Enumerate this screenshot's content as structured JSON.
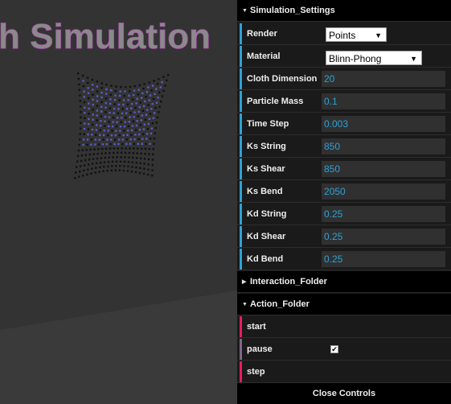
{
  "scene": {
    "title_text": "h Simulation"
  },
  "gui": {
    "simulation_folder": {
      "title": "Simulation_Settings",
      "render": {
        "label": "Render",
        "value": "Points"
      },
      "material": {
        "label": "Material",
        "value": "Blinn-Phong"
      },
      "params": [
        {
          "label": "Cloth Dimension",
          "value": "20"
        },
        {
          "label": "Particle Mass",
          "value": "0.1"
        },
        {
          "label": "Time Step",
          "value": "0.003"
        },
        {
          "label": "Ks String",
          "value": "850"
        },
        {
          "label": "Ks Shear",
          "value": "850"
        },
        {
          "label": "Ks Bend",
          "value": "2050"
        },
        {
          "label": "Kd String",
          "value": "0.25"
        },
        {
          "label": "Kd Shear",
          "value": "0.25"
        },
        {
          "label": "Kd Bend",
          "value": "0.25"
        }
      ]
    },
    "interaction_folder": {
      "title": "Interaction_Folder"
    },
    "action_folder": {
      "title": "Action_Folder",
      "start": {
        "label": "start"
      },
      "pause": {
        "label": "pause",
        "checked": true
      },
      "step": {
        "label": "step"
      }
    },
    "close_label": "Close Controls"
  },
  "colors": {
    "function_accent": "#e61d5f",
    "number_accent": "#2fa1d6",
    "boolean_accent": "#806787",
    "option_accent": "#2fa1d6"
  }
}
